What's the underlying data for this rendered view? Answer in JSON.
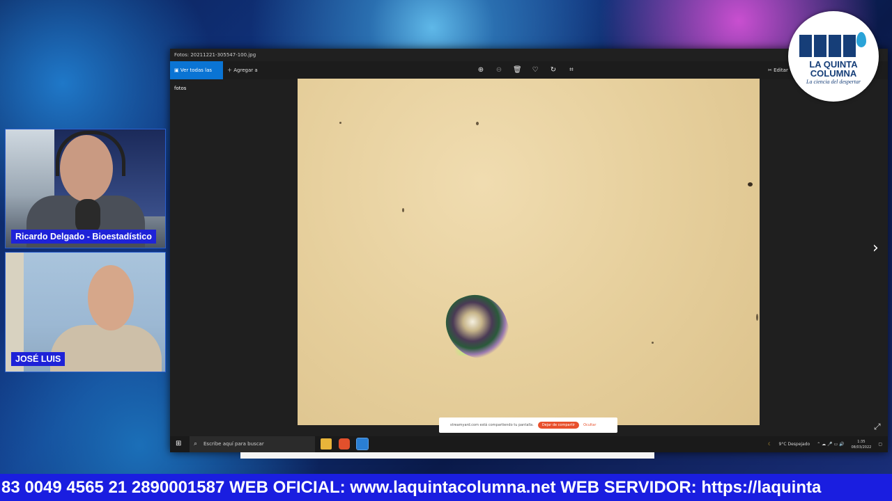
{
  "window": {
    "title": "Fotos: 20211221-305547-100.jpg"
  },
  "toolbar": {
    "see_all": "Ver todas las fotos",
    "add_to": "Agregar a",
    "edit": "Editar"
  },
  "share_bar": {
    "message": "streamyard.com está compartiendo tu pantalla.",
    "stop": "Dejar de compartir",
    "hide": "Ocultar"
  },
  "taskbar": {
    "search_placeholder": "Escribe aquí para buscar",
    "weather": "9°C Despejado",
    "time": "1:35",
    "date": "08/03/2022"
  },
  "cameras": [
    {
      "name": "Ricardo Delgado - Bioestadístico"
    },
    {
      "name": "JOSÉ LUIS"
    }
  ],
  "logo": {
    "line1": "LA QUINTA",
    "line2": "COLUMNA",
    "tagline": "La ciencia del despertar"
  },
  "ticker": {
    "text": "83 0049 4565 21 2890001587 WEB OFICIAL: www.laquintacolumna.net WEB SERVIDOR: https://laquinta"
  },
  "icons": {
    "zoom_in": "zoom-in-icon",
    "zoom_out": "zoom-out-icon",
    "delete": "trash-icon",
    "favorite": "heart-icon",
    "rotate": "rotate-icon",
    "crop": "crop-icon",
    "next": "chevron-right-icon",
    "expand": "expand-icon"
  },
  "colors": {
    "ticker_bg": "#1a1ee0",
    "nameplate_bg": "#1e22d8",
    "accent_blue": "#0a74d4",
    "stop_share": "#e8502c"
  }
}
